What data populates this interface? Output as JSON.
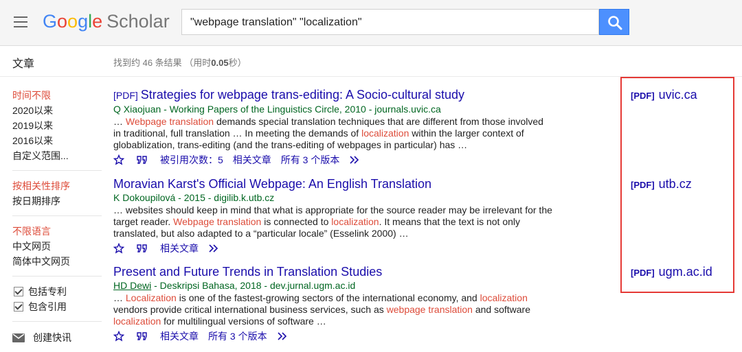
{
  "header": {
    "logo_letters": [
      "G",
      "o",
      "o",
      "g",
      "l",
      "e"
    ],
    "logo_suffix": "Scholar",
    "search_value": "\"webpage translation\" \"localization\""
  },
  "subheader": {
    "section_label": "文章",
    "stats_prefix": "找到约 46 条结果 （用时",
    "stats_time": "0.05",
    "stats_suffix": "秒）"
  },
  "sidebar": {
    "time_filters": [
      "时间不限",
      "2020以来",
      "2019以来",
      "2016以来",
      "自定义范围..."
    ],
    "sort_options": [
      "按相关性排序",
      "按日期排序"
    ],
    "language_options": [
      "不限语言",
      "中文网页",
      "简体中文网页"
    ],
    "checkboxes": [
      "包括专利",
      "包含引用"
    ],
    "alert_label": "创建快讯"
  },
  "results": [
    {
      "tag": "[PDF]",
      "title": "Strategies for webpage trans-editing: A Socio-cultural study",
      "author": "Q Xiaojuan",
      "meta_rest": " - Working Papers of the Linguistics Circle, 2010 - journals.uvic.ca",
      "snippet": [
        {
          "t": "… "
        },
        {
          "t": "Webpage translation",
          "h": true
        },
        {
          "t": " demands special translation techniques that are different from those involved in traditional, full translation … In meeting the demands of "
        },
        {
          "t": "localization",
          "h": true
        },
        {
          "t": " within the larger context of globablization, trans-editing (and the trans-editing of webpages in particular) has …"
        }
      ],
      "actions": [
        "被引用次数：5",
        "相关文章",
        "所有 3 个版本"
      ],
      "pdf_tag": "[PDF]",
      "pdf_domain": "uvic.ca"
    },
    {
      "tag": "",
      "title": "Moravian Karst's Official Webpage: An English Translation",
      "author": "K Dokoupilová",
      "meta_rest": " - 2015 - digilib.k.utb.cz",
      "snippet": [
        {
          "t": "… websites should keep in mind that what is appropriate for the source reader may be irrelevant for the target reader. "
        },
        {
          "t": "Webpage translation",
          "h": true
        },
        {
          "t": " is connected to "
        },
        {
          "t": "localization",
          "h": true
        },
        {
          "t": ". It means that the text is not only translated, but also adapted to a “particular locale” (Esselink 2000) …"
        }
      ],
      "actions": [
        "相关文章"
      ],
      "pdf_tag": "[PDF]",
      "pdf_domain": "utb.cz"
    },
    {
      "tag": "",
      "title": "Present and Future Trends in Translation Studies",
      "author": "HD Dewi",
      "meta_rest": " - Deskripsi Bahasa, 2018 - dev.jurnal.ugm.ac.id",
      "snippet": [
        {
          "t": "… "
        },
        {
          "t": "Localization",
          "h": true
        },
        {
          "t": " is one of the fastest-growing sectors of the international economy, and "
        },
        {
          "t": "localization",
          "h": true
        },
        {
          "t": " vendors provide critical international business services, such as "
        },
        {
          "t": "webpage translation",
          "h": true
        },
        {
          "t": " and software "
        },
        {
          "t": "localization",
          "h": true
        },
        {
          "t": " for multilingual versions of software …"
        }
      ],
      "actions": [
        "相关文章",
        "所有 3 个版本"
      ],
      "pdf_tag": "[PDF]",
      "pdf_domain": "ugm.ac.id"
    }
  ],
  "colors": {
    "link": "#1a0dab",
    "highlight": "#dd4b39",
    "source": "#006621",
    "annotation_box": "#e53935",
    "search_button": "#4d90fe"
  }
}
